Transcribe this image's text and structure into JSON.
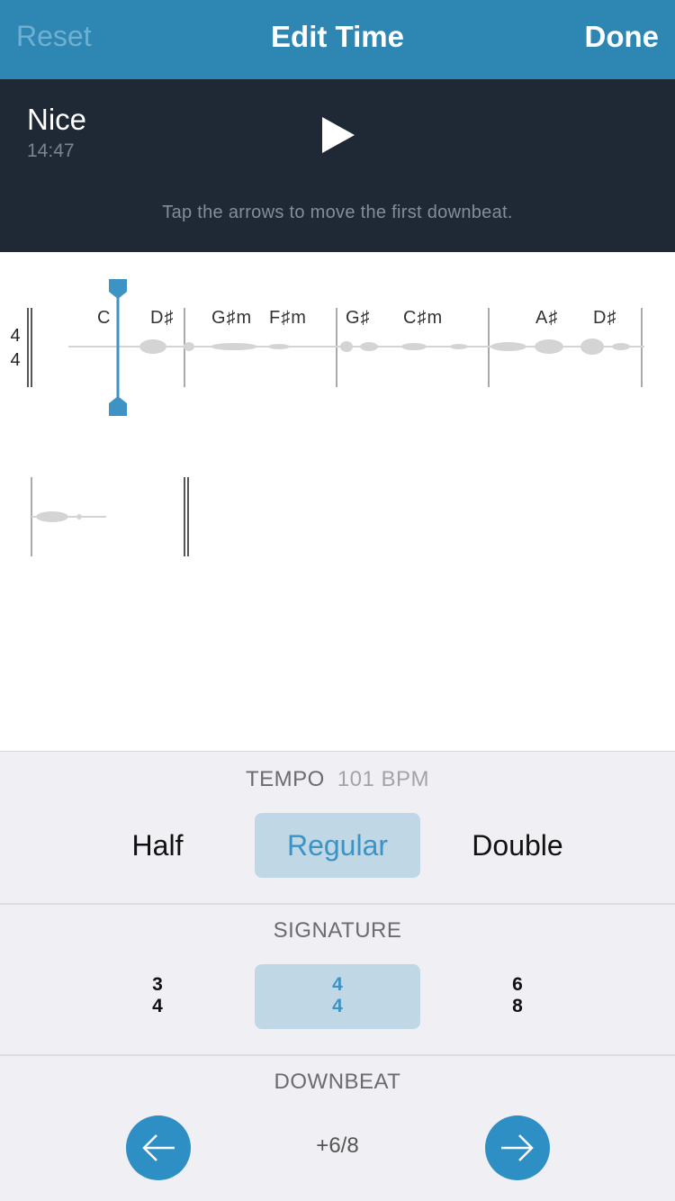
{
  "nav": {
    "reset": "Reset",
    "title": "Edit Time",
    "done": "Done"
  },
  "player": {
    "song_title": "Nice",
    "duration": "14:47",
    "play_icon": "play-icon",
    "hint": "Tap the arrows to move the first downbeat."
  },
  "score": {
    "time_signature": {
      "top": "4",
      "bottom": "4"
    },
    "chords": [
      "C",
      "D♯",
      "G♯m",
      "F♯m",
      "G♯",
      "C♯m",
      "A♯",
      "D♯"
    ]
  },
  "tempo": {
    "label": "TEMPO",
    "bpm": "101 BPM",
    "options": [
      "Half",
      "Regular",
      "Double"
    ],
    "selected": "Regular"
  },
  "signature": {
    "label": "SIGNATURE",
    "options": [
      {
        "top": "3",
        "bottom": "4"
      },
      {
        "top": "4",
        "bottom": "4"
      },
      {
        "top": "6",
        "bottom": "8"
      }
    ],
    "selected": "4/4"
  },
  "downbeat": {
    "label": "DOWNBEAT",
    "value": "+6/8",
    "left_icon": "arrow-left-icon",
    "right_icon": "arrow-right-icon"
  },
  "colors": {
    "nav_bg": "#2e86b3",
    "player_bg": "#1f2835",
    "accent": "#3c93c4",
    "selected_bg": "#c0d7e6"
  }
}
